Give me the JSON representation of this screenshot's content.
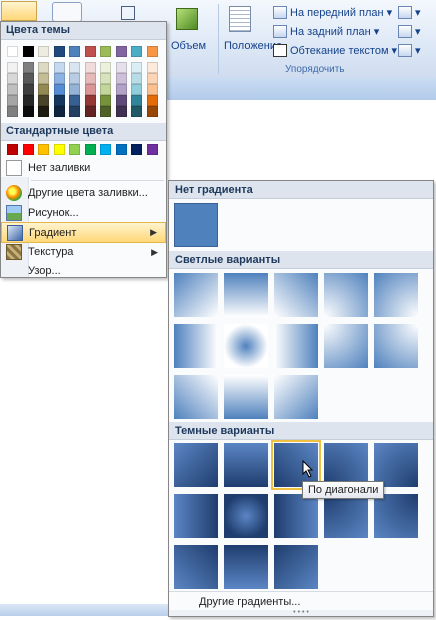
{
  "ribbon": {
    "object_label": "Объем",
    "position_label": "Положение",
    "bring_front": "На передний план",
    "send_back": "На задний план",
    "text_wrap": "Обтекание текстом",
    "group_arrange": "Упорядочить"
  },
  "menu": {
    "theme_colors_header": "Цвета темы",
    "standard_colors_header": "Стандартные цвета",
    "no_fill": "Нет заливки",
    "more_fill_colors": "Другие цвета заливки...",
    "picture": "Рисунок...",
    "gradient": "Градиент",
    "texture": "Текстура",
    "pattern": "Узор..."
  },
  "theme_colors": [
    [
      "#ffffff",
      "#000000",
      "#eeece1",
      "#1f497d",
      "#4f81bd",
      "#c0504d",
      "#9bbb59",
      "#8064a2",
      "#4bacc6",
      "#f79646"
    ],
    [
      "#f2f2f2",
      "#7f7f7f",
      "#ddd9c3",
      "#c6d9f0",
      "#dbe5f1",
      "#f2dcdb",
      "#ebf1dd",
      "#e5e0ec",
      "#dbeef3",
      "#fdeada"
    ],
    [
      "#d8d8d8",
      "#595959",
      "#c4bd97",
      "#8db3e2",
      "#b8cce4",
      "#e5b9b7",
      "#d7e3bc",
      "#ccc1d9",
      "#b7dde8",
      "#fbd5b5"
    ],
    [
      "#bfbfbf",
      "#3f3f3f",
      "#938953",
      "#548dd4",
      "#95b3d7",
      "#d99694",
      "#c3d69b",
      "#b2a2c7",
      "#92cddc",
      "#fac08f"
    ],
    [
      "#a5a5a5",
      "#262626",
      "#494429",
      "#17365d",
      "#366092",
      "#953734",
      "#76923c",
      "#5f497a",
      "#31859b",
      "#e36c09"
    ],
    [
      "#7f7f7f",
      "#0c0c0c",
      "#1d1b10",
      "#0f243e",
      "#244061",
      "#632423",
      "#4f6128",
      "#3f3151",
      "#205867",
      "#974806"
    ]
  ],
  "standard_colors": [
    "#c00000",
    "#ff0000",
    "#ffc000",
    "#ffff00",
    "#92d050",
    "#00b050",
    "#00b0f0",
    "#0070c0",
    "#002060",
    "#7030a0"
  ],
  "flyout": {
    "no_gradient_header": "Нет градиента",
    "light_header": "Светлые варианты",
    "dark_header": "Темные варианты",
    "more_gradients": "Другие градиенты...",
    "tooltip": "По диагонали"
  },
  "colors": {
    "accent_blue": "#4f81bd",
    "hover": "#ffd778"
  }
}
